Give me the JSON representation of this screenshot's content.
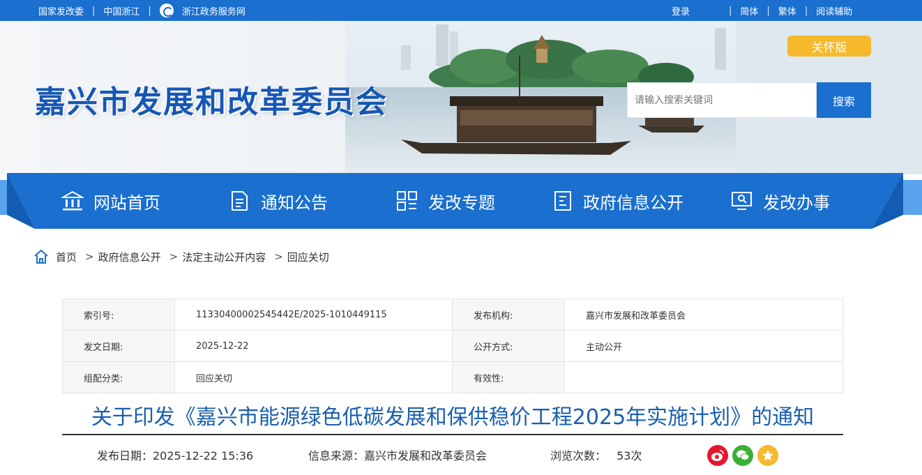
{
  "topbar": {
    "left_links": [
      "国家发改委",
      "中国浙江",
      "浙江政务服务网"
    ],
    "right_links": [
      "登录",
      "简体",
      "繁体",
      "阅读辅助"
    ]
  },
  "header": {
    "site_title": "嘉兴市发展和改革委员会",
    "care_mode_label": "关怀版",
    "search_placeholder": "请输入搜索关键词",
    "search_button": "搜索"
  },
  "nav": {
    "items": [
      {
        "label": "网站首页",
        "icon": "bank-icon"
      },
      {
        "label": "通知公告",
        "icon": "document-icon"
      },
      {
        "label": "发改专题",
        "icon": "grid-icon"
      },
      {
        "label": "政府信息公开",
        "icon": "file-list-icon"
      },
      {
        "label": "发改办事",
        "icon": "monitor-icon"
      }
    ]
  },
  "breadcrumb": [
    "首页",
    "政府信息公开",
    "法定主动公开内容",
    "回应关切"
  ],
  "info_table": {
    "rows": [
      [
        {
          "k": "索引号:",
          "v": "11330400002545442E/2025-1010449115"
        },
        {
          "k": "发布机构:",
          "v": "嘉兴市发展和改革委员会"
        }
      ],
      [
        {
          "k": "发文日期:",
          "v": "2025-12-22"
        },
        {
          "k": "公开方式:",
          "v": "主动公开"
        }
      ],
      [
        {
          "k": "组配分类:",
          "v": "回应关切"
        },
        {
          "k": "有效性:",
          "v": ""
        }
      ]
    ]
  },
  "article": {
    "title": "关于印发《嘉兴市能源绿色低碳发展和保供稳价工程2025年实施计划》的通知",
    "publish_date": "发布日期：2025-12-22 15:36",
    "source": "信息来源：嘉兴市发展和改革委员会",
    "views_label": "浏览次数：",
    "views_count": "53次"
  },
  "colors": {
    "primary": "#1a6fcf",
    "title_blue": "#1a5fae",
    "care_yellow": "#f5b92b",
    "weibo": "#e6162d",
    "wechat": "#3cb034",
    "favorite": "#f5b92b"
  }
}
